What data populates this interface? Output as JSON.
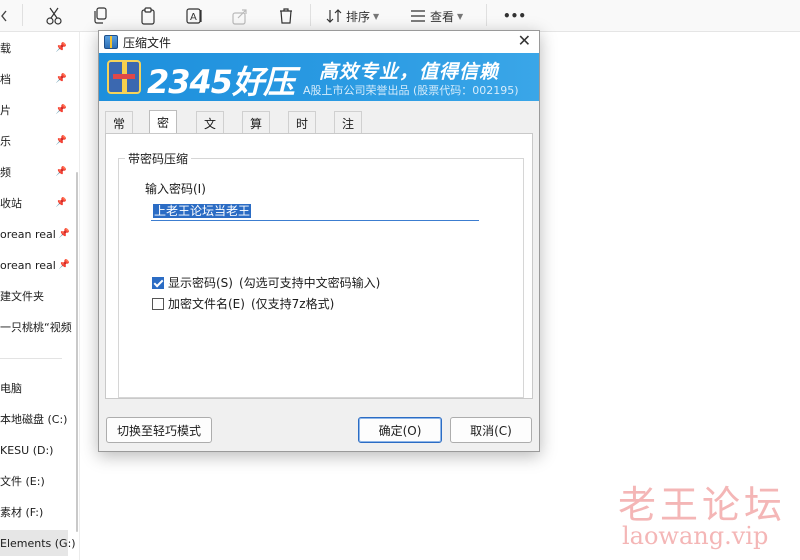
{
  "explorer": {
    "toolbar": {
      "sort_label": "排序",
      "view_label": "查看",
      "more_label": "•••"
    },
    "nav_items": [
      {
        "label": "载",
        "pinned": true
      },
      {
        "label": "档",
        "pinned": true
      },
      {
        "label": "片",
        "pinned": true
      },
      {
        "label": "乐",
        "pinned": true
      },
      {
        "label": "频",
        "pinned": true
      },
      {
        "label": "收站",
        "pinned": true
      },
      {
        "label": "orean real",
        "pinned": true
      },
      {
        "label": "orean real",
        "pinned": true
      },
      {
        "label": "建文件夹",
        "pinned": false
      },
      {
        "label": "一只桃桃“视频",
        "pinned": false
      },
      {
        "label": "电脑",
        "pinned": false
      },
      {
        "label": "本地磁盘 (C:)",
        "pinned": false
      },
      {
        "label": "KESU (D:)",
        "pinned": false
      },
      {
        "label": "文件 (E:)",
        "pinned": false
      },
      {
        "label": "素材 (F:)",
        "pinned": false
      },
      {
        "label": "Elements (G:)",
        "pinned": false
      }
    ]
  },
  "dialog": {
    "title": "压缩文件",
    "close_glyph": "✕",
    "banner": {
      "brand": "2345好压",
      "slogan": "高效专业，值得信赖",
      "subtitle": "A股上市公司荣誉出品 (股票代码：002195)"
    },
    "tabs": [
      "常规",
      "密码",
      "文件",
      "算法",
      "时间",
      "注释"
    ],
    "active_tab": 1,
    "group_title": "带密码压缩",
    "password": {
      "label": "输入密码(I)",
      "value": "上老王论坛当老王"
    },
    "show_password": {
      "label": "显示密码(S)",
      "note": "(勾选可支持中文密码输入)",
      "checked": true
    },
    "encrypt_names": {
      "label": "加密文件名(E)",
      "note": "(仅支持7z格式)",
      "checked": false
    },
    "buttons": {
      "light_mode": "切换至轻巧模式",
      "ok": "确定(O)",
      "cancel": "取消(C)"
    }
  },
  "watermark": {
    "title": "老王论坛",
    "url": "laowang.vip"
  },
  "colors": {
    "banner": "#2a9ae2",
    "selection": "#2b6cc4",
    "watermark": "#f4b6b6"
  }
}
